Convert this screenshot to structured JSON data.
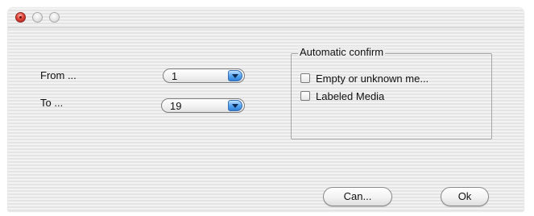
{
  "window": {
    "title": ""
  },
  "range": {
    "from_label": "From ...",
    "from_value": "1",
    "to_label": "To ...",
    "to_value": "19"
  },
  "auto_confirm": {
    "title": "Automatic confirm",
    "options": [
      {
        "label": "Empty or unknown me...",
        "checked": false
      },
      {
        "label": "Labeled Media",
        "checked": false
      }
    ]
  },
  "buttons": {
    "cancel_label": "Can...",
    "ok_label": "Ok"
  },
  "colors": {
    "window_bg": "#ececec",
    "close_button": "#e0443a",
    "popup_arrow": "#5aa6f0"
  },
  "icons": {
    "close": "close-icon",
    "minimize": "minimize-icon",
    "zoom": "zoom-icon",
    "popup_arrow": "chevron-down-icon"
  }
}
